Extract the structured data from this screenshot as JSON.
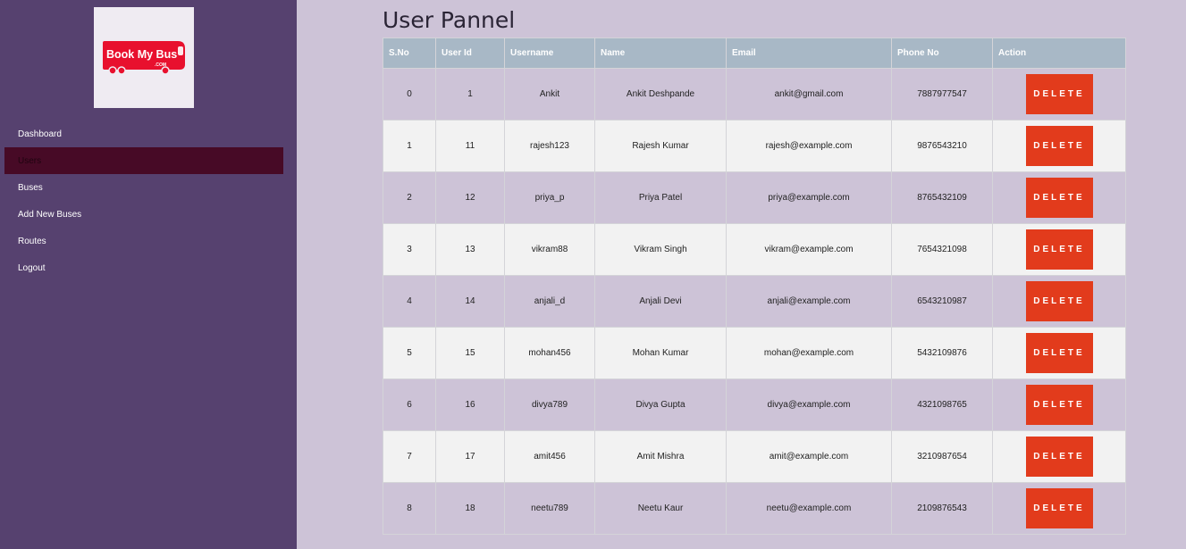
{
  "sidebar": {
    "logo_text": "Book My Bus",
    "logo_sub": ".COM",
    "items": [
      {
        "label": "Dashboard",
        "active": false
      },
      {
        "label": "Users",
        "active": true
      },
      {
        "label": "Buses",
        "active": false
      },
      {
        "label": "Add New Buses",
        "active": false
      },
      {
        "label": "Routes",
        "active": false
      },
      {
        "label": "Logout",
        "active": false
      }
    ]
  },
  "page": {
    "title": "User Pannel"
  },
  "table": {
    "headers": [
      "S.No",
      "User Id",
      "Username",
      "Name",
      "Email",
      "Phone No",
      "Action"
    ],
    "delete_label": "DELETE",
    "rows": [
      {
        "sno": "0",
        "id": "1",
        "username": "Ankit",
        "name": "Ankit Deshpande",
        "email": "ankit@gmail.com",
        "phone": "7887977547"
      },
      {
        "sno": "1",
        "id": "11",
        "username": "rajesh123",
        "name": "Rajesh Kumar",
        "email": "rajesh@example.com",
        "phone": "9876543210"
      },
      {
        "sno": "2",
        "id": "12",
        "username": "priya_p",
        "name": "Priya Patel",
        "email": "priya@example.com",
        "phone": "8765432109"
      },
      {
        "sno": "3",
        "id": "13",
        "username": "vikram88",
        "name": "Vikram Singh",
        "email": "vikram@example.com",
        "phone": "7654321098"
      },
      {
        "sno": "4",
        "id": "14",
        "username": "anjali_d",
        "name": "Anjali Devi",
        "email": "anjali@example.com",
        "phone": "6543210987"
      },
      {
        "sno": "5",
        "id": "15",
        "username": "mohan456",
        "name": "Mohan Kumar",
        "email": "mohan@example.com",
        "phone": "5432109876"
      },
      {
        "sno": "6",
        "id": "16",
        "username": "divya789",
        "name": "Divya Gupta",
        "email": "divya@example.com",
        "phone": "4321098765"
      },
      {
        "sno": "7",
        "id": "17",
        "username": "amit456",
        "name": "Amit Mishra",
        "email": "amit@example.com",
        "phone": "3210987654"
      },
      {
        "sno": "8",
        "id": "18",
        "username": "neetu789",
        "name": "Neetu Kaur",
        "email": "neetu@example.com",
        "phone": "2109876543"
      }
    ]
  },
  "colors": {
    "sidebar_bg": "#56416f",
    "active_item": "#470a26",
    "header_bg": "#a8b8c6",
    "delete_button": "#e23b1c",
    "brand_red": "#e8102e"
  }
}
